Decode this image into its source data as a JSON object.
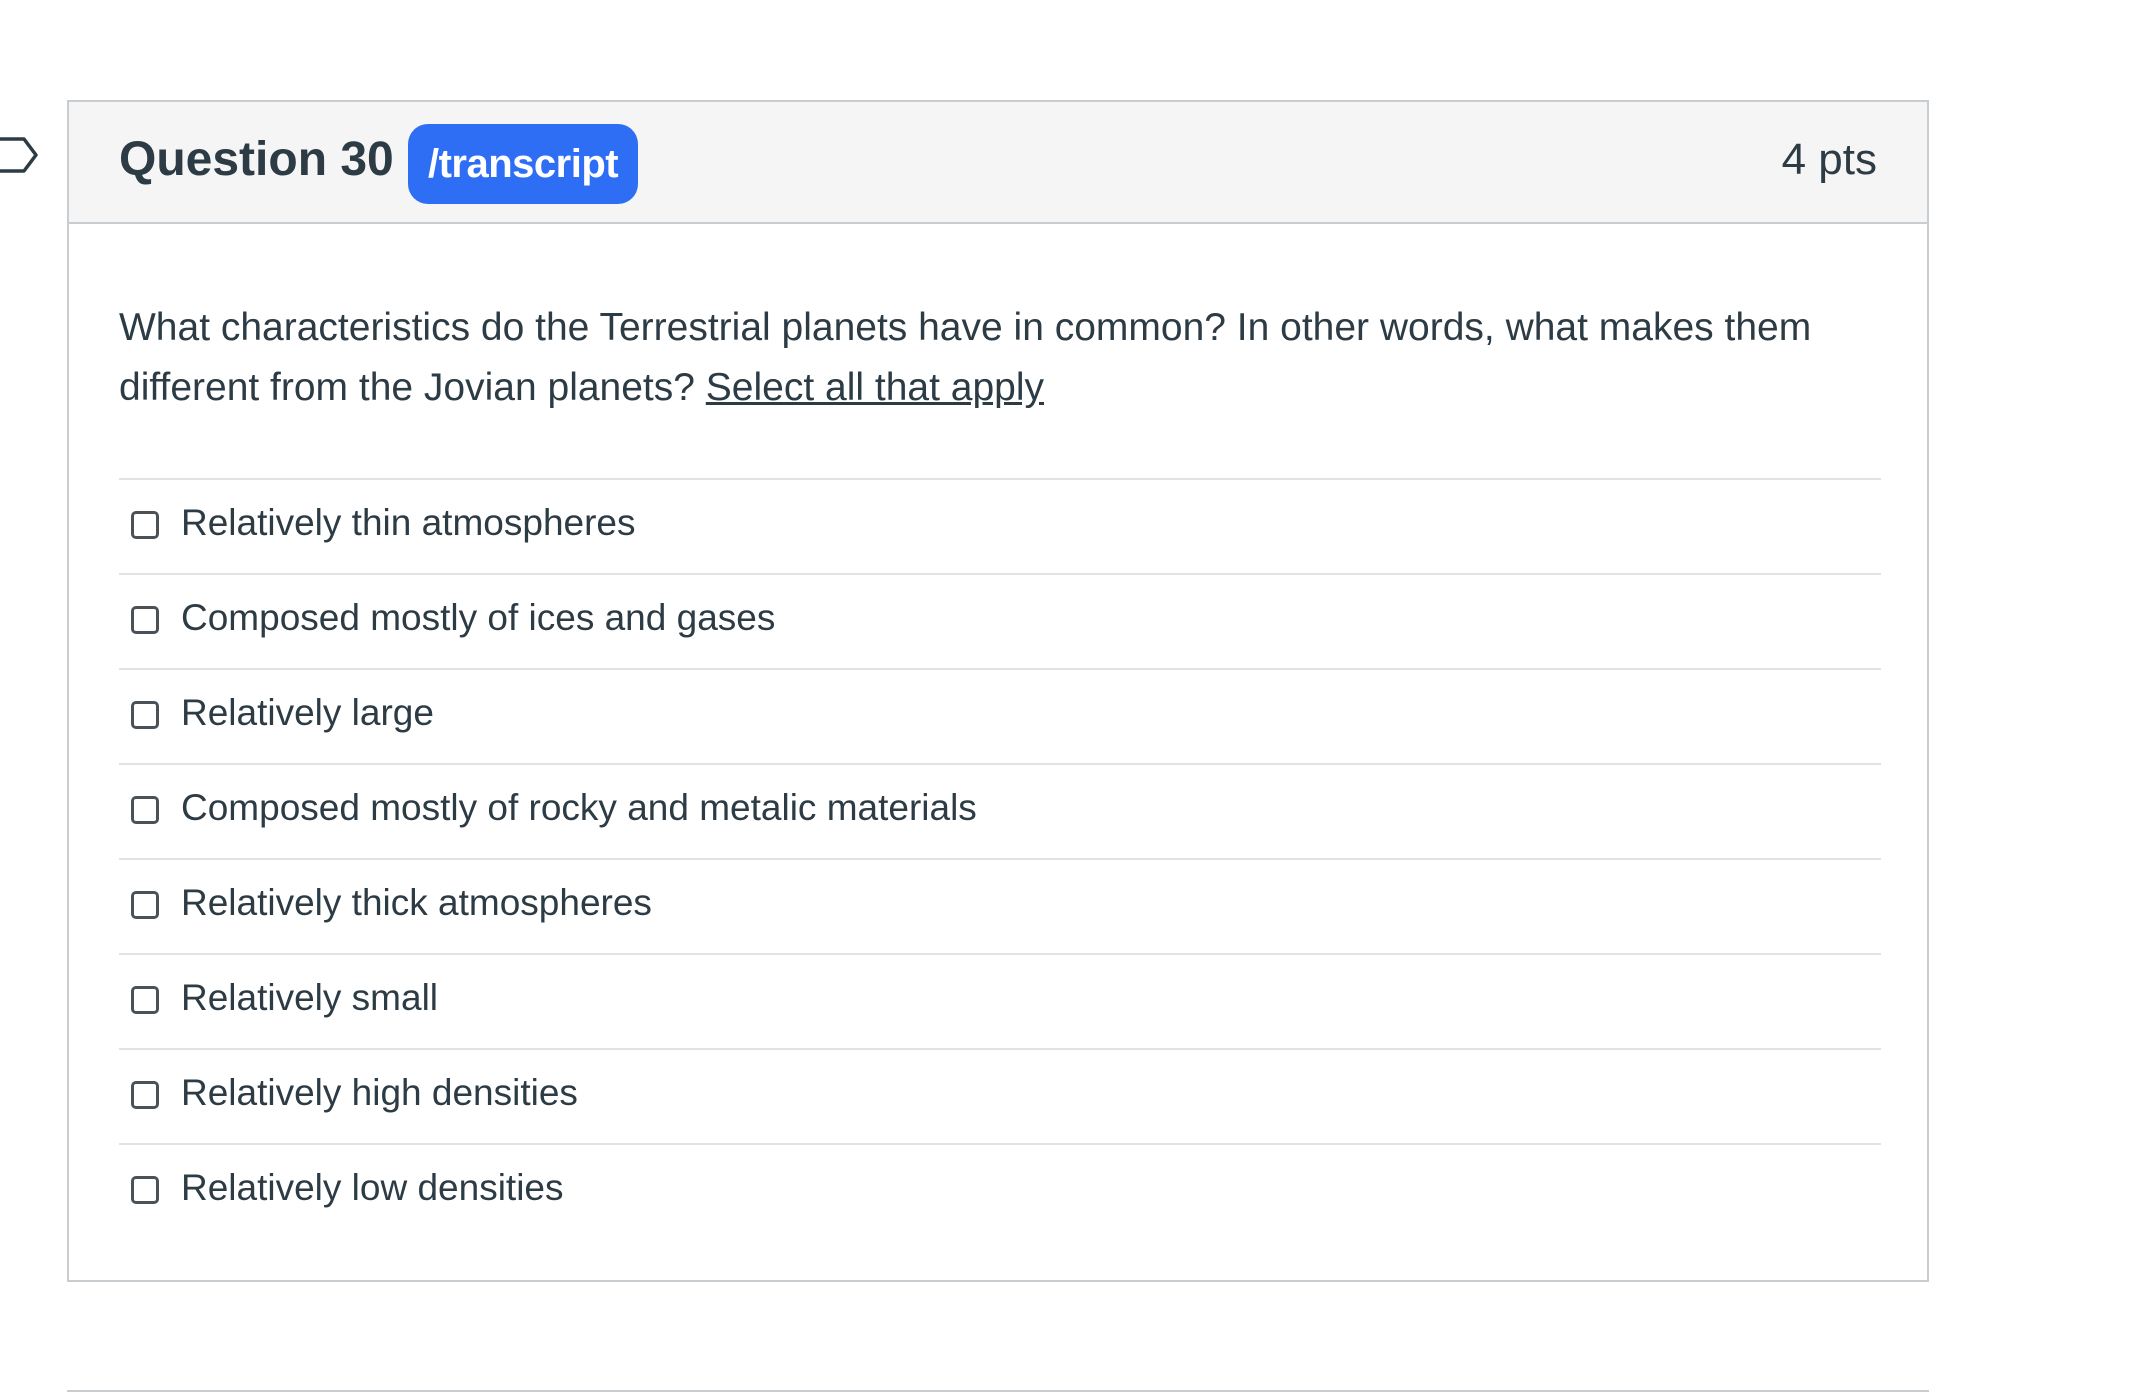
{
  "question": {
    "title": "Question 30",
    "badge_label": "/transcript",
    "points": "4 pts",
    "text_main": "What characteristics do the Terrestrial planets have in common? In other words, what makes them different from the Jovian planets? ",
    "text_underlined": "Select all that apply",
    "answers": [
      "Relatively thin atmospheres",
      "Composed mostly of ices and gases",
      "Relatively large",
      "Composed mostly of rocky and metalic materials",
      "Relatively thick atmospheres",
      "Relatively small",
      "Relatively high densities",
      "Relatively low densities"
    ]
  },
  "colors": {
    "badge": "#2e6ef5",
    "header_bg": "#f5f5f5",
    "text": "#2d3b45",
    "border": "#c7cdd1"
  }
}
